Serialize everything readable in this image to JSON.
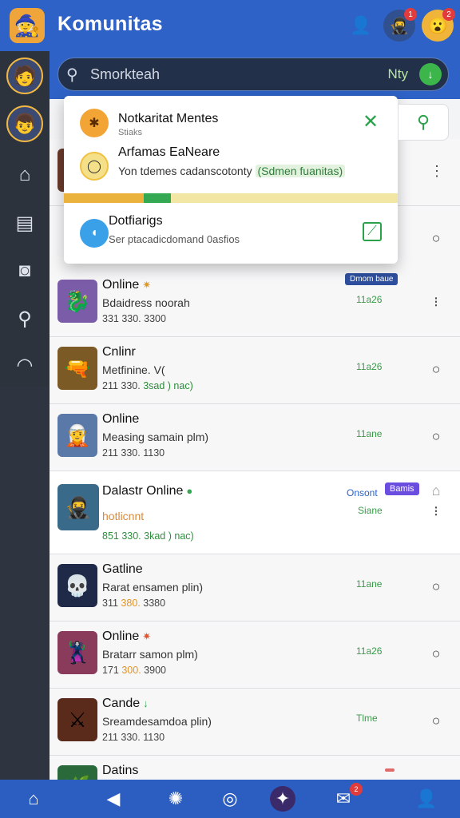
{
  "app": {
    "title": "Komunitas",
    "logo_icon": "game-character-icon",
    "header_icons": [
      "user-icon",
      "avatar-character-icon",
      "emoji-icon"
    ],
    "header_badges": [
      "1",
      "2"
    ]
  },
  "search": {
    "placeholder": "Smorkteah",
    "filter_label": "Nty"
  },
  "popup": {
    "items": [
      {
        "title": "Notkaritat Mentes",
        "subtitle": "Stiaks",
        "icon": "swirl-icon",
        "right_icon": "close-icon"
      },
      {
        "title": "Arfamas EaNeare",
        "subtitle": "Yon tdemes cadanscotonty",
        "tag": "(Sdmen fuanitas)",
        "icon": "circle-icon"
      },
      {
        "title": "Dotfiarigs",
        "subtitle": "Ser ptacadicdomand 0asfios",
        "icon": "chat-icon",
        "right_icon": "edit-icon"
      }
    ],
    "progress_1": 0.24,
    "progress_2": 0.08
  },
  "list": [
    {
      "name": "Online",
      "emoji": "✷",
      "sub": "Bdaidress noorah",
      "meta_a": "331 330.",
      "meta_b": "3300",
      "stat": "11a26",
      "badge": "Dmom baue"
    },
    {
      "name": "Cnlinr",
      "emoji": "",
      "sub": "Metfinine.  V(",
      "meta_a": "211 330.",
      "meta_b": "3sad ) nac)",
      "stat": "11a26",
      "badge": ""
    },
    {
      "name": "Online",
      "emoji": "",
      "sub": "Measing samain plm)",
      "meta_a": "211 330.",
      "meta_b": "1130",
      "stat": "11ane",
      "badge": ""
    },
    {
      "name": "Dalastr Online",
      "emoji": "●",
      "sub": "hotlicnnt",
      "meta_a": "851 330.",
      "meta_b": "3kad ) nac)",
      "stat": "Siane",
      "badge": "Bamis",
      "status_label": "Onsont"
    },
    {
      "name": "Gatline",
      "emoji": "",
      "sub": "Rarat ensamen plin)",
      "meta_a": "311",
      "meta_mid": "380.",
      "meta_b": "3380",
      "stat": "11ane",
      "badge": ""
    },
    {
      "name": "Online",
      "emoji": "✷",
      "sub": "Bratarr samon plm)",
      "meta_a": "171",
      "meta_mid": "300.",
      "meta_b": "3900",
      "stat": "11a26",
      "badge": ""
    },
    {
      "name": "Cande",
      "emoji": "↓",
      "sub": "Sreamdesamdoa plin)",
      "meta_a": "211 330.",
      "meta_b": "1130",
      "stat": "Tlme",
      "badge": ""
    },
    {
      "name": "Datins",
      "emoji": "",
      "sub": "",
      "meta_a": "",
      "meta_b": "",
      "stat": "",
      "badge": ""
    }
  ],
  "bottom_nav": {
    "icons": [
      "home-icon",
      "back-icon",
      "settings-icon",
      "record-icon",
      "galaxy-icon",
      "mail-icon",
      "profile-icon"
    ],
    "mail_badge": "2"
  },
  "colors": {
    "header": "#2e62c6",
    "rail": "#2c333d",
    "accent_green": "#3cb54a",
    "badge_red": "#e23b3b"
  }
}
